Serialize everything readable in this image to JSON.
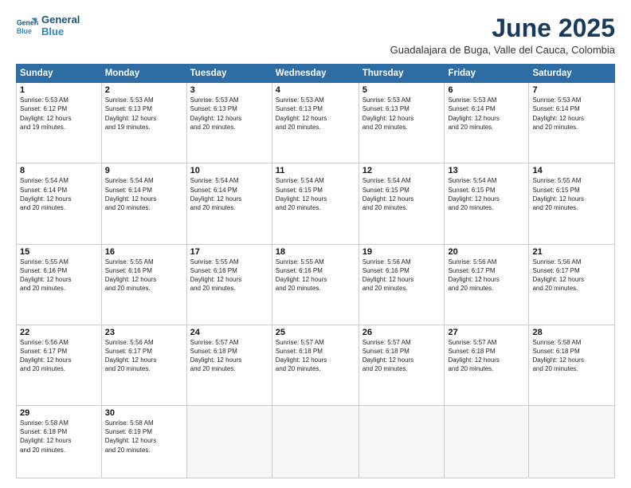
{
  "logo": {
    "line1": "General",
    "line2": "Blue"
  },
  "title": "June 2025",
  "subtitle": "Guadalajara de Buga, Valle del Cauca, Colombia",
  "headers": [
    "Sunday",
    "Monday",
    "Tuesday",
    "Wednesday",
    "Thursday",
    "Friday",
    "Saturday"
  ],
  "weeks": [
    [
      {
        "day": "1",
        "info": "Sunrise: 5:53 AM\nSunset: 6:12 PM\nDaylight: 12 hours\nand 19 minutes."
      },
      {
        "day": "2",
        "info": "Sunrise: 5:53 AM\nSunset: 6:13 PM\nDaylight: 12 hours\nand 19 minutes."
      },
      {
        "day": "3",
        "info": "Sunrise: 5:53 AM\nSunset: 6:13 PM\nDaylight: 12 hours\nand 20 minutes."
      },
      {
        "day": "4",
        "info": "Sunrise: 5:53 AM\nSunset: 6:13 PM\nDaylight: 12 hours\nand 20 minutes."
      },
      {
        "day": "5",
        "info": "Sunrise: 5:53 AM\nSunset: 6:13 PM\nDaylight: 12 hours\nand 20 minutes."
      },
      {
        "day": "6",
        "info": "Sunrise: 5:53 AM\nSunset: 6:14 PM\nDaylight: 12 hours\nand 20 minutes."
      },
      {
        "day": "7",
        "info": "Sunrise: 5:53 AM\nSunset: 6:14 PM\nDaylight: 12 hours\nand 20 minutes."
      }
    ],
    [
      {
        "day": "8",
        "info": "Sunrise: 5:54 AM\nSunset: 6:14 PM\nDaylight: 12 hours\nand 20 minutes."
      },
      {
        "day": "9",
        "info": "Sunrise: 5:54 AM\nSunset: 6:14 PM\nDaylight: 12 hours\nand 20 minutes."
      },
      {
        "day": "10",
        "info": "Sunrise: 5:54 AM\nSunset: 6:14 PM\nDaylight: 12 hours\nand 20 minutes."
      },
      {
        "day": "11",
        "info": "Sunrise: 5:54 AM\nSunset: 6:15 PM\nDaylight: 12 hours\nand 20 minutes."
      },
      {
        "day": "12",
        "info": "Sunrise: 5:54 AM\nSunset: 6:15 PM\nDaylight: 12 hours\nand 20 minutes."
      },
      {
        "day": "13",
        "info": "Sunrise: 5:54 AM\nSunset: 6:15 PM\nDaylight: 12 hours\nand 20 minutes."
      },
      {
        "day": "14",
        "info": "Sunrise: 5:55 AM\nSunset: 6:15 PM\nDaylight: 12 hours\nand 20 minutes."
      }
    ],
    [
      {
        "day": "15",
        "info": "Sunrise: 5:55 AM\nSunset: 6:16 PM\nDaylight: 12 hours\nand 20 minutes."
      },
      {
        "day": "16",
        "info": "Sunrise: 5:55 AM\nSunset: 6:16 PM\nDaylight: 12 hours\nand 20 minutes."
      },
      {
        "day": "17",
        "info": "Sunrise: 5:55 AM\nSunset: 6:16 PM\nDaylight: 12 hours\nand 20 minutes."
      },
      {
        "day": "18",
        "info": "Sunrise: 5:55 AM\nSunset: 6:16 PM\nDaylight: 12 hours\nand 20 minutes."
      },
      {
        "day": "19",
        "info": "Sunrise: 5:56 AM\nSunset: 6:16 PM\nDaylight: 12 hours\nand 20 minutes."
      },
      {
        "day": "20",
        "info": "Sunrise: 5:56 AM\nSunset: 6:17 PM\nDaylight: 12 hours\nand 20 minutes."
      },
      {
        "day": "21",
        "info": "Sunrise: 5:56 AM\nSunset: 6:17 PM\nDaylight: 12 hours\nand 20 minutes."
      }
    ],
    [
      {
        "day": "22",
        "info": "Sunrise: 5:56 AM\nSunset: 6:17 PM\nDaylight: 12 hours\nand 20 minutes."
      },
      {
        "day": "23",
        "info": "Sunrise: 5:56 AM\nSunset: 6:17 PM\nDaylight: 12 hours\nand 20 minutes."
      },
      {
        "day": "24",
        "info": "Sunrise: 5:57 AM\nSunset: 6:18 PM\nDaylight: 12 hours\nand 20 minutes."
      },
      {
        "day": "25",
        "info": "Sunrise: 5:57 AM\nSunset: 6:18 PM\nDaylight: 12 hours\nand 20 minutes."
      },
      {
        "day": "26",
        "info": "Sunrise: 5:57 AM\nSunset: 6:18 PM\nDaylight: 12 hours\nand 20 minutes."
      },
      {
        "day": "27",
        "info": "Sunrise: 5:57 AM\nSunset: 6:18 PM\nDaylight: 12 hours\nand 20 minutes."
      },
      {
        "day": "28",
        "info": "Sunrise: 5:58 AM\nSunset: 6:18 PM\nDaylight: 12 hours\nand 20 minutes."
      }
    ],
    [
      {
        "day": "29",
        "info": "Sunrise: 5:58 AM\nSunset: 6:18 PM\nDaylight: 12 hours\nand 20 minutes."
      },
      {
        "day": "30",
        "info": "Sunrise: 5:58 AM\nSunset: 6:19 PM\nDaylight: 12 hours\nand 20 minutes."
      },
      {
        "day": "",
        "info": ""
      },
      {
        "day": "",
        "info": ""
      },
      {
        "day": "",
        "info": ""
      },
      {
        "day": "",
        "info": ""
      },
      {
        "day": "",
        "info": ""
      }
    ]
  ]
}
